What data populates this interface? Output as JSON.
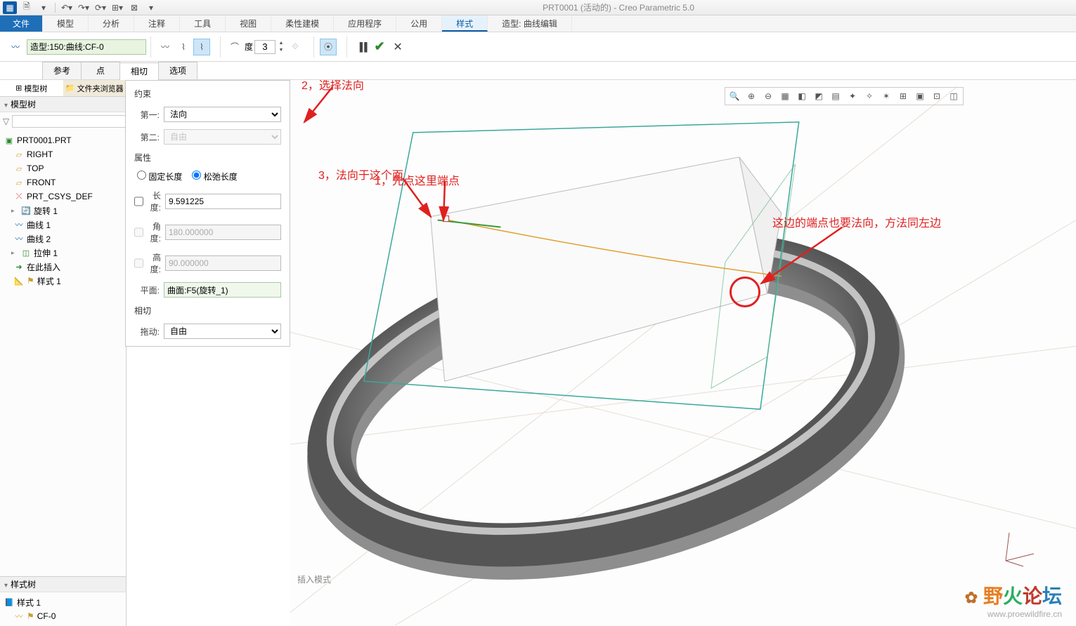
{
  "title": "PRT0001 (活动的) - Creo Parametric 5.0",
  "menus": [
    "文件",
    "模型",
    "分析",
    "注释",
    "工具",
    "视图",
    "柔性建模",
    "应用程序",
    "公用",
    "样式",
    "造型: 曲线编辑"
  ],
  "menu_active_idx": 9,
  "curve_selector": "造型:150:曲线:CF-0",
  "degree_label": "度",
  "degree_value": "3",
  "subtabs": [
    "参考",
    "点",
    "相切",
    "选项"
  ],
  "subtab_active": 2,
  "side": {
    "tab_model": "模型树",
    "tab_folder": "文件夹浏览器",
    "hdr_model": "模型树",
    "hdr_style": "样式树"
  },
  "tree_items": [
    {
      "d": 0,
      "ico": "📄",
      "cls": "",
      "txt": "PRT0001.PRT"
    },
    {
      "d": 1,
      "ico": "▱",
      "cls": "ico-plane",
      "txt": "RIGHT"
    },
    {
      "d": 1,
      "ico": "▱",
      "cls": "ico-plane",
      "txt": "TOP"
    },
    {
      "d": 1,
      "ico": "▱",
      "cls": "ico-plane",
      "txt": "FRONT"
    },
    {
      "d": 1,
      "ico": "⤫",
      "cls": "ico-csys",
      "txt": "PRT_CSYS_DEF"
    },
    {
      "d": 1,
      "ico": "🔄",
      "cls": "",
      "txt": "旋转 1",
      "exp": "▸"
    },
    {
      "d": 1,
      "ico": "〰",
      "cls": "ico-curve",
      "txt": "曲线 1"
    },
    {
      "d": 1,
      "ico": "〰",
      "cls": "ico-curve",
      "txt": "曲线 2"
    },
    {
      "d": 1,
      "ico": "◫",
      "cls": "ico-ext",
      "txt": "拉伸 1",
      "exp": "▸"
    },
    {
      "d": 1,
      "ico": "➜",
      "cls": "ico-ins",
      "txt": "在此插入"
    },
    {
      "d": 1,
      "ico": "🏷",
      "cls": "ico-style",
      "txt": "样式 1",
      "flag": true
    }
  ],
  "style_tree": [
    {
      "ico": "📘",
      "txt": "样式 1"
    },
    {
      "ico": "〰",
      "txt": "CF-0",
      "cls": "ico-style",
      "flag": true
    }
  ],
  "props": {
    "sec_constraint": "约束",
    "first": "第一:",
    "first_val": "法向",
    "second": "第二:",
    "second_val": "自由",
    "sec_attr": "属性",
    "fixed_len": "固定长度",
    "relax_len": "松弛长度",
    "length": "长度:",
    "length_val": "9.591225",
    "angle": "角度:",
    "angle_val": "180.000000",
    "height": "高度:",
    "height_val": "90.000000",
    "plane": "平面:",
    "plane_val": "曲面:F5(旋转_1)",
    "sec_tan": "相切",
    "drag": "拖动:",
    "drag_val": "自由"
  },
  "annos": {
    "a1": "1，先点这里端点",
    "a2": "2，选择法向",
    "a3": "3，法向于这个面",
    "a4": "这边的端点也要法向，方法同左边"
  },
  "status_mode": "插入模式",
  "watermark_name": "野火论坛",
  "watermark_url": "www.proewildfire.cn"
}
